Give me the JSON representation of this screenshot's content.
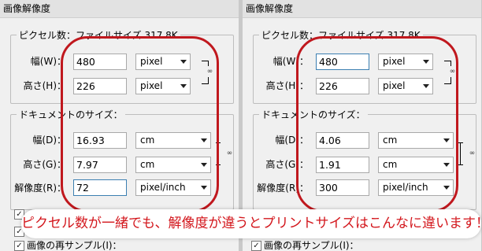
{
  "dialogs": [
    {
      "title": "画像解像度",
      "pixel_group": "ピクセル数：ファイルサイズ 317.8K",
      "width_label": "幅(W)：",
      "width_value": "480",
      "width_unit": "pixel",
      "height_label": "高さ(H)：",
      "height_value": "226",
      "height_unit": "pixel",
      "doc_group": "ドキュメントのサイズ：",
      "doc_width_label": "幅(D)：",
      "doc_width_value": "16.93",
      "doc_width_unit": "cm",
      "doc_height_label": "高さ(G)：",
      "doc_height_value": "7.97",
      "doc_height_unit": "cm",
      "res_label": "解像度(R)：",
      "res_value": "72",
      "res_unit": "pixel/inch",
      "resample_label": "画像の再サンプル(I)："
    },
    {
      "title": "画像解像度",
      "pixel_group": "ピクセル数：ファイルサイズ 317.8K",
      "width_label": "幅(W)：",
      "width_value": "480",
      "width_unit": "pixel",
      "height_label": "高さ(H)：",
      "height_value": "226",
      "height_unit": "pixel",
      "doc_group": "ドキュメントのサイズ：",
      "doc_width_label": "幅(D)：",
      "doc_width_value": "4.06",
      "doc_width_unit": "cm",
      "doc_height_label": "高さ(G)：",
      "doc_height_value": "1.91",
      "doc_height_unit": "cm",
      "res_label": "解像度(R)：",
      "res_value": "300",
      "res_unit": "pixel/inch",
      "resample_label": "画像の再サンプル(I)："
    }
  ],
  "annotation": {
    "text": "ピクセル数が一緒でも、解像度が違うとプリントサイズはこんなに違います！！",
    "highlight_color": "#c0181e"
  },
  "icons": {
    "chain": "link-chain-icon",
    "dropdown": "chevron-down-icon",
    "checkbox_mark": "✓"
  }
}
